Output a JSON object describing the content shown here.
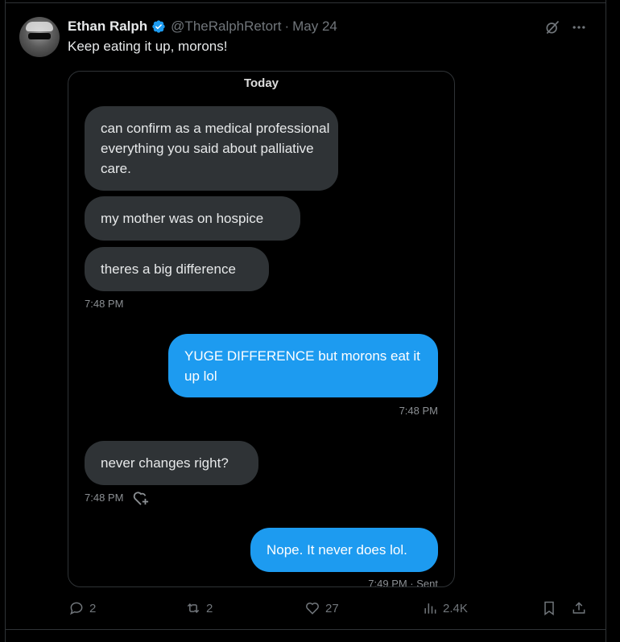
{
  "tweet": {
    "author_name": "Ethan Ralph",
    "handle": "@TheRalphRetort",
    "separator": "·",
    "date": "May 24",
    "text": "Keep eating it up, morons!"
  },
  "chat": {
    "day_label": "Today",
    "messages": [
      {
        "side": "incoming",
        "text": "can confirm as a medical professional everything you said about palliative care."
      },
      {
        "side": "incoming",
        "text": "my mother was on hospice"
      },
      {
        "side": "incoming",
        "text": "theres a big difference"
      },
      {
        "side": "outgoing",
        "text": "YUGE DIFFERENCE but morons eat it up lol"
      },
      {
        "side": "incoming",
        "text": "never changes right?"
      },
      {
        "side": "outgoing",
        "text": "Nope. It never does lol."
      }
    ],
    "timestamps": [
      "7:48 PM",
      "7:48 PM",
      "7:48 PM",
      "7:49 PM · Sent"
    ]
  },
  "actions": {
    "replies": "2",
    "reposts": "2",
    "likes": "27",
    "views": "2.4K"
  },
  "icons": [
    "verified-badge-icon",
    "grok-icon",
    "more-icon",
    "reply-icon",
    "repost-icon",
    "like-icon",
    "views-icon",
    "bookmark-icon",
    "share-icon",
    "add-reaction-icon"
  ],
  "colors": {
    "accent": "#1d9bf0",
    "muted": "#71767b",
    "bubble_incoming": "#2f3336"
  }
}
